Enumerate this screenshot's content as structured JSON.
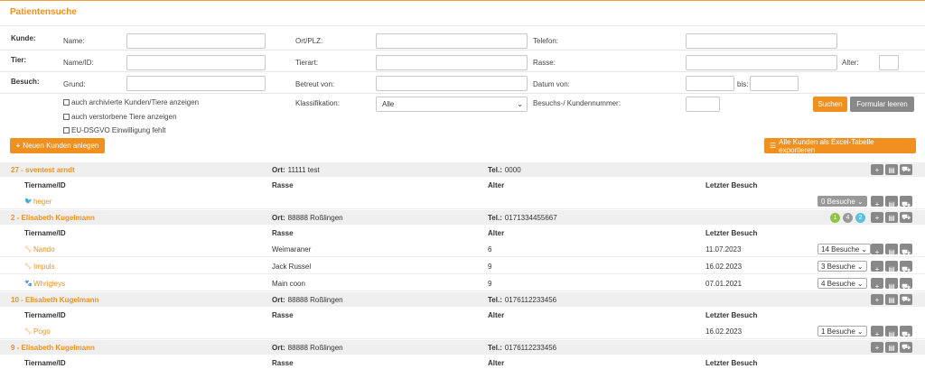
{
  "page_title": "Patientensuche",
  "form": {
    "groups": {
      "kunde": "Kunde:",
      "tier": "Tier:",
      "besuch": "Besuch:"
    },
    "labels": {
      "name": "Name:",
      "ort_plz": "Ort/PLZ:",
      "telefon": "Telefon:",
      "name_id": "Name/ID:",
      "tierart": "Tierart:",
      "rasse": "Rasse:",
      "alter": "Alter:",
      "grund": "Grund:",
      "betreut_von": "Betreut von:",
      "datum_von": "Datum von:",
      "bis": "bis:",
      "klassifikation": "Klassifikation:",
      "besuchs_kundennummer": "Besuchs-/ Kundennummer:"
    },
    "checkboxes": {
      "archiv": "auch archivierte Kunden/Tiere anzeigen",
      "verstorben": "auch verstorbene Tiere anzeigen",
      "dsgvo": "EU-DSGVO Einwilligung fehlt"
    },
    "klassifikation_value": "Alle",
    "search_button": "Suchen",
    "reset_button": "Formular leeren"
  },
  "actions": {
    "new_customer": "Neuen Kunden anlegen",
    "export": "Alle Kunden als Excel-Tabelle exportieren"
  },
  "table_headers": {
    "tiername": "Tiername/ID",
    "rasse": "Rasse",
    "alter": "Alter",
    "letzter_besuch": "Letzter Besuch"
  },
  "customers": [
    {
      "name": "27 - sventest arndt",
      "ort_label": "Ort:",
      "ort": "11111 test",
      "tel_label": "Tel.:",
      "tel": "0000",
      "animals": [
        {
          "name": "heger",
          "rasse": "",
          "alter": "",
          "besuch": "",
          "visits": "0 Besuche"
        }
      ]
    },
    {
      "name": "2 - Elisabeth Kugelmann",
      "ort_label": "Ort:",
      "ort": "88888 Roßlingen",
      "tel_label": "Tel.:",
      "tel": "0171334455667",
      "badges": [
        "1",
        "4",
        "2"
      ],
      "animals": [
        {
          "name": "Nando",
          "rasse": "Weimaraner",
          "alter": "6",
          "besuch": "11.07.2023",
          "visits": "14 Besuche"
        },
        {
          "name": "Impuls",
          "rasse": "Jack Russel",
          "alter": "9",
          "besuch": "16.02.2023",
          "visits": "3 Besuche"
        },
        {
          "name": "Whrigleys",
          "rasse": "Main coon",
          "alter": "9",
          "besuch": "07.01.2021",
          "visits": "4 Besuche"
        }
      ]
    },
    {
      "name": "10 - Elisabeth Kugelmann",
      "ort_label": "Ort:",
      "ort": "88888 Roßlingen",
      "tel_label": "Tel.:",
      "tel": "0176112233456",
      "animals": [
        {
          "name": "Pogo",
          "rasse": "",
          "alter": "",
          "besuch": "16.02.2023",
          "visits": "1 Besuche"
        }
      ]
    },
    {
      "name": "9 - Elisabeth Kugelmann",
      "ort_label": "Ort:",
      "ort": "88888 Roßlingen",
      "tel_label": "Tel.:",
      "tel": "0176112233456",
      "animals": []
    }
  ],
  "colors": {
    "accent": "#f0901e",
    "button_grey": "#888888",
    "row_bg": "#efefef",
    "badge_green": "#8cc63f",
    "badge_grey": "#999999",
    "badge_teal": "#5bc0de"
  }
}
